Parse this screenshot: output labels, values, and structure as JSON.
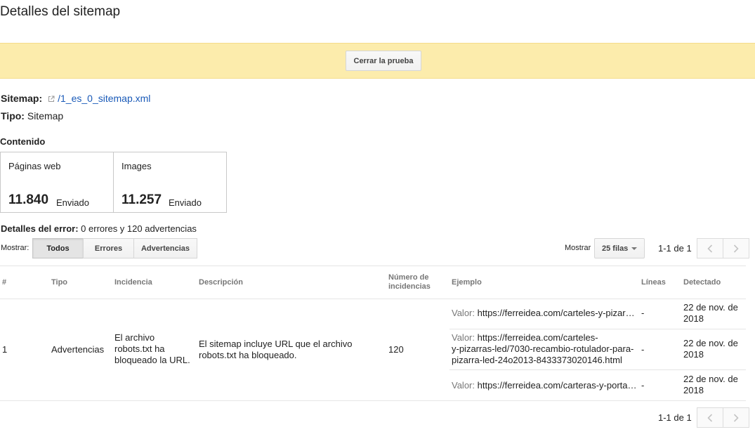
{
  "page": {
    "title": "Detalles del sitemap"
  },
  "banner": {
    "close_button": "Cerrar la prueba"
  },
  "sitemap": {
    "label": "Sitemap:",
    "path": "/1_es_0_sitemap.xml",
    "type_label": "Tipo:",
    "type_value": "Sitemap"
  },
  "content": {
    "title": "Contenido",
    "cells": [
      {
        "label": "Páginas web",
        "count": "11.840",
        "unit": "Enviado"
      },
      {
        "label": "Images",
        "count": "11.257",
        "unit": "Enviado"
      }
    ]
  },
  "errors": {
    "label": "Detalles del error:",
    "summary": "0 errores y 120 advertencias"
  },
  "filter": {
    "label": "Mostrar:",
    "buttons": [
      "Todos",
      "Errores",
      "Advertencias"
    ],
    "active": "Todos"
  },
  "rows": {
    "label": "Mostrar",
    "value": "25 filas"
  },
  "pager": {
    "range": "1-1 de 1"
  },
  "table": {
    "headers": {
      "num": "#",
      "tipo": "Tipo",
      "incidencia": "Incidencia",
      "descripcion": "Descripción",
      "numero_line1": "Número de",
      "numero_line2": "incidencias",
      "ejemplo": "Ejemplo",
      "lineas": "Líneas",
      "detectado": "Detectado"
    },
    "row": {
      "num": "1",
      "tipo": "Advertencias",
      "incidencia_lines": [
        "El archivo",
        "robots.txt ha",
        "bloqueado la URL."
      ],
      "descripcion_lines": [
        "El sitemap incluye URL que el archivo",
        "robots.txt ha bloqueado."
      ],
      "numero": "120",
      "examples": [
        {
          "value_label": "Valor:",
          "url": "https://ferreidea.com/carteles-y-pizar…",
          "url_lines": [],
          "lineas": "-",
          "detectado_lines": [
            "22 de nov. de",
            "2018"
          ]
        },
        {
          "value_label": "Valor:",
          "url": "https://ferreidea.com/carteles-",
          "url_lines": [
            "y-pizarras-led/7030-recambio-rotulador-para-",
            "pizarra-led-24o2013-8433373020146.html"
          ],
          "lineas": "-",
          "detectado_lines": [
            "22 de nov. de",
            "2018"
          ]
        },
        {
          "value_label": "Valor:",
          "url": "https://ferreidea.com/carteras-y-porta…",
          "url_lines": [],
          "lineas": "-",
          "detectado_lines": [
            "22 de nov. de",
            "2018"
          ]
        }
      ]
    }
  }
}
